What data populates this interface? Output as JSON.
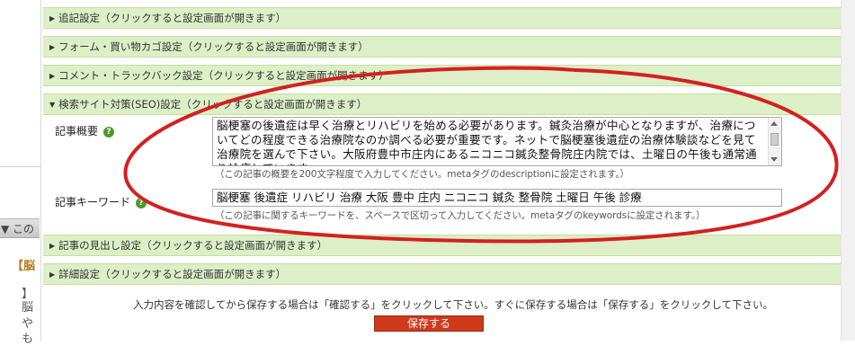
{
  "left_panel": {
    "tab_label": "▼ この",
    "post_title": "【脳",
    "snippets": [
      "脳",
      "や",
      "も"
    ],
    "rounded_char": "】"
  },
  "sections": {
    "tsuiki": "追記設定（クリックすると設定画面が開きます）",
    "form": "フォーム・買い物カゴ設定（クリックすると設定画面が開きます）",
    "comment": "コメント・トラックバック設定（クリックすると設定画面が開きます）",
    "seo": "検索サイト対策(SEO)設定（クリックすると設定画面が開きます）",
    "heading": "記事の見出し設定（クリックすると設定画面が開きます）",
    "detail": "詳細設定（クリックすると設定画面が開きます）"
  },
  "seo": {
    "summary_label": "記事概要",
    "summary_value": "脳梗塞の後遺症は早く治療とリハビリを始める必要があります。鍼灸治療が中心となりますが、治療についてどの程度できる治療院なのか調べる必要が重要です。ネットで脳梗塞後遺症の治療体験談などを見て治療院を選んで下さい。大阪府豊中市庄内にあるニコニコ鍼灸整骨院庄内院では、土曜日の午後も通常通り診療しています。",
    "summary_hint": "（この記事の概要を200文字程度で入力してください。metaタグのdescriptionに設定されます。）",
    "keyword_label": "記事キーワード",
    "keyword_value": "脳梗塞  後遺症  リハビリ  治療  大阪  豊中  庄内  ニコニコ  鍼灸  整骨院  土曜日  午後  診療",
    "keyword_hint": "（この記事に関するキーワードを、スペースで区切って入力してください。metaタグのkeywordsに設定されます。）",
    "help_glyph": "?"
  },
  "footer": {
    "note": "入力内容を確認してから保存する場合は「確認する」をクリックして下さい。すぐに保存する場合は「保存する」をクリックして下さい。",
    "save_label": "保存する"
  },
  "colors": {
    "section_bg": "#dcefc7",
    "section_border": "#c5df9d",
    "save_button": "#cf3a1c",
    "annotation_ellipse": "#d42020",
    "help_icon": "#4e9a2c"
  }
}
